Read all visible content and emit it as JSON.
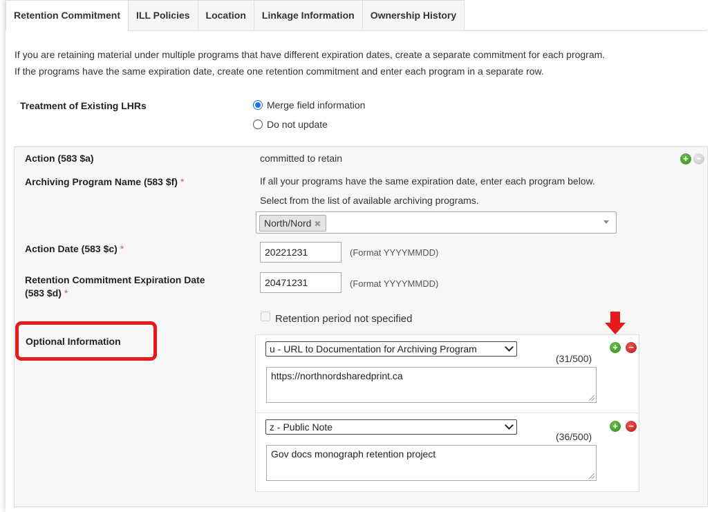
{
  "tabs": [
    {
      "label": "Retention Commitment",
      "active": true
    },
    {
      "label": "ILL Policies",
      "active": false
    },
    {
      "label": "Location",
      "active": false
    },
    {
      "label": "Linkage Information",
      "active": false
    },
    {
      "label": "Ownership History",
      "active": false
    }
  ],
  "intro": {
    "line1": "If you are retaining material under multiple programs that have different expiration dates, create a separate commitment for each program.",
    "line2": "If the programs have the same expiration date, create one retention commitment and enter each program in a separate row."
  },
  "treatment": {
    "label": "Treatment of Existing LHRs",
    "options": [
      {
        "label": "Merge field information",
        "checked": true
      },
      {
        "label": "Do not update",
        "checked": false
      }
    ]
  },
  "action": {
    "label": "Action (583 $a)",
    "value": "committed to retain"
  },
  "archiving": {
    "label": "Archiving Program Name (583 $f)",
    "required_mark": "*",
    "help1": "If all your programs have the same expiration date, enter each program below.",
    "help2": "Select from the list of available archiving programs.",
    "selected_chip": "North/Nord",
    "chip_remove": "✖"
  },
  "action_date": {
    "label": "Action Date (583 $c)",
    "required_mark": "*",
    "value": "20221231",
    "hint": "(Format YYYYMMDD)"
  },
  "expiration": {
    "label_line1": "Retention Commitment Expiration Date",
    "label_line2": "(583 $d)",
    "required_mark": "*",
    "value": "20471231",
    "hint": "(Format YYYYMMDD)"
  },
  "retention_period": {
    "label": "Retention period not specified",
    "checked": false
  },
  "optional": {
    "label": "Optional Information",
    "rows": [
      {
        "subfield": "u - URL to Documentation for Archiving Program",
        "count": "(31/500)",
        "text": "https://northnordsharedprint.ca"
      },
      {
        "subfield": "z - Public Note",
        "count": "(36/500)",
        "text": "Gov docs monograph retention project"
      }
    ]
  },
  "colors": {
    "accent": "#1a73e8",
    "highlight": "#e8191b",
    "add": "#2e8b1e",
    "remove": "#b71c1c"
  },
  "icons": {
    "add": "plus-circle-icon",
    "remove": "minus-circle-icon",
    "arrow": "down-arrow-icon"
  }
}
